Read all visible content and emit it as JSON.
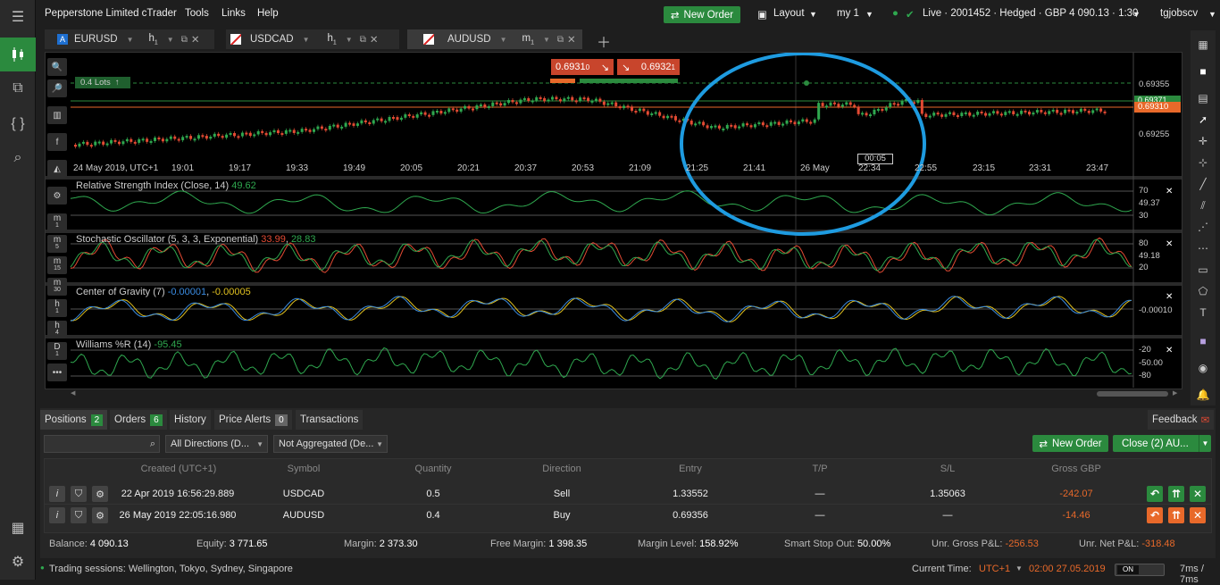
{
  "app": {
    "title": "Pepperstone Limited cTrader",
    "menu": [
      "Tools",
      "Links",
      "Help"
    ],
    "new_order_label": "New Order",
    "layout_label": "Layout",
    "workspace_label": "my 1",
    "account_info": "Live · 2001452 · Hedged · GBP 4 090.13 · 1:30",
    "user": "tgjobscv"
  },
  "tabs": [
    {
      "symbol": "EURUSD",
      "tf_main": "h",
      "tf_sub": "1",
      "badge": "A"
    },
    {
      "symbol": "USDCAD",
      "tf_main": "h",
      "tf_sub": "1"
    },
    {
      "symbol": "AUDUSD",
      "tf_main": "m",
      "tf_sub": "1"
    }
  ],
  "chart": {
    "sell_price": "0.6931",
    "sell_pip": "0",
    "buy_price": "0.6932",
    "buy_pip": "1",
    "lots_label": "0.4 Lots",
    "price_ticks": [
      "0.69355",
      "0.69255"
    ],
    "price_tag": "0.69310",
    "price_tag_green": "0.69371",
    "countdown": "00:05",
    "time_labels": [
      "24 May 2019, UTC+1",
      "19:01",
      "19:17",
      "19:33",
      "19:49",
      "20:05",
      "20:21",
      "20:37",
      "20:53",
      "21:09",
      "21:25",
      "21:41",
      "26 May",
      "22:34",
      "22:55",
      "23:15",
      "23:31",
      "23:47"
    ],
    "timeframes": [
      {
        "main": "m",
        "sub": "1"
      },
      {
        "main": "m",
        "sub": "5"
      },
      {
        "main": "m",
        "sub": "15"
      },
      {
        "main": "m",
        "sub": "30"
      },
      {
        "main": "h",
        "sub": "1"
      },
      {
        "main": "h",
        "sub": "4"
      },
      {
        "main": "D",
        "sub": "1"
      }
    ]
  },
  "indicators": {
    "rsi": {
      "name": "Relative Strength Index (Close, 14)",
      "value": "49.62",
      "levels": [
        "70",
        "30"
      ],
      "current": "49.37"
    },
    "stoch": {
      "name": "Stochastic Oscillator (5, 3, 3, Exponential)",
      "value1": "33.99",
      "value2": "28.83",
      "levels": [
        "80",
        "20"
      ],
      "current": "49.18"
    },
    "cog": {
      "name": "Center of Gravity (7)",
      "value1": "-0.00001",
      "value2": "-0.00005",
      "current": "-0.00010"
    },
    "wpr": {
      "name": "Williams %R (14)",
      "value": "-95.45",
      "levels": [
        "-20",
        "-80"
      ],
      "current": "-50.00"
    }
  },
  "colors": {
    "accent_green": "#2b8a3e",
    "sell_red": "#c8452c",
    "loss_orange": "#e8692a",
    "candle_up": "#2fa84f",
    "candle_down": "#e34a33",
    "annotation_circle": "#1e9be0"
  },
  "bottom": {
    "tabs": [
      {
        "label": "Positions",
        "count": "2"
      },
      {
        "label": "Orders",
        "count": "6"
      },
      {
        "label": "History"
      },
      {
        "label": "Price Alerts",
        "count": "0"
      },
      {
        "label": "Transactions"
      }
    ],
    "feedback_label": "Feedback",
    "filter_direction": "All Directions (D...",
    "filter_aggregate": "Not Aggregated (De...",
    "new_order_label": "New Order",
    "close_label": "Close (2) AU...",
    "columns": [
      "Created  (UTC+1)",
      "Symbol",
      "Quantity",
      "Direction",
      "Entry",
      "T/P",
      "S/L",
      "Gross GBP"
    ],
    "rows": [
      {
        "created": "22 Apr 2019 16:56:29.889",
        "symbol": "USDCAD",
        "quantity": "0.5",
        "direction": "Sell",
        "entry": "1.33552",
        "tp": "—",
        "sl": "1.35063",
        "gross": "-242.07"
      },
      {
        "created": "26 May 2019 22:05:16.980",
        "symbol": "AUDUSD",
        "quantity": "0.4",
        "direction": "Buy",
        "entry": "0.69356",
        "tp": "—",
        "sl": "—",
        "gross": "-14.46"
      }
    ],
    "summary": {
      "balance_label": "Balance:",
      "balance": "4 090.13",
      "equity_label": "Equity:",
      "equity": "3 771.65",
      "margin_label": "Margin:",
      "margin": "2 373.30",
      "free_margin_label": "Free Margin:",
      "free_margin": "1 398.35",
      "margin_level_label": "Margin Level:",
      "margin_level": "158.92%",
      "stop_out_label": "Smart Stop Out:",
      "stop_out": "50.00%",
      "unr_gross_label": "Unr. Gross P&L:",
      "unr_gross": "-256.53",
      "unr_net_label": "Unr. Net P&L:",
      "unr_net": "-318.48"
    }
  },
  "status": {
    "sessions": "Trading sessions: Wellington, Tokyo, Sydney, Singapore",
    "current_time_label": "Current Time:",
    "tz": "UTC+1",
    "time": "02:00 27.05.2019",
    "toggle": "ON",
    "latency": "7ms / 7ms"
  }
}
